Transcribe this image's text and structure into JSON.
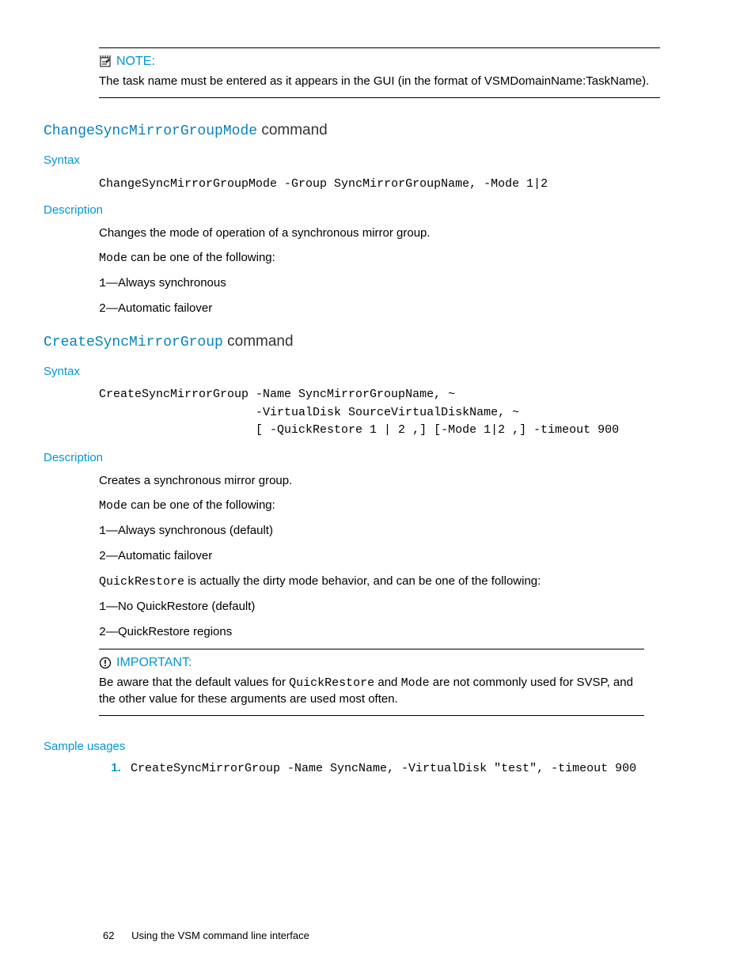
{
  "note": {
    "label": "NOTE:",
    "body": "The task name must be entered as it appears in the GUI (in the format of VSMDomainName:TaskName)."
  },
  "cmd1": {
    "heading_code": "ChangeSyncMirrorGroupMode",
    "heading_tail": " command",
    "syntax_label": "Syntax",
    "syntax_prefix": "ChangeSyncMirrorGroupMode",
    "syntax_tail": " -Group SyncMirrorGroupName, -Mode 1|2",
    "desc_label": "Description",
    "desc_line": "Changes the mode of operation of a synchronous mirror group.",
    "mode_label": "Mode",
    "mode_tail": " can be one of the following:",
    "m1_code": "1",
    "m1_tail": "—Always synchronous",
    "m2_code": "2",
    "m2_tail": "—Automatic failover"
  },
  "cmd2": {
    "heading_code": "CreateSyncMirrorGroup",
    "heading_tail": " command",
    "syntax_label": "Syntax",
    "syntax_block": "CreateSyncMirrorGroup -Name SyncMirrorGroupName, ~\n                      -VirtualDisk SourceVirtualDiskName, ~\n                      [ -QuickRestore 1 | 2 ,] [-Mode 1|2 ,] -timeout 900",
    "desc_label": "Description",
    "desc_line": "Creates a synchronous mirror group.",
    "mode_label": "Mode",
    "mode_tail": " can be one of the following:",
    "m1_code": "1",
    "m1_tail": "—Always synchronous (default)",
    "m2_code": "2",
    "m2_tail": "—Automatic failover",
    "qr_label": "QuickRestore",
    "qr_tail": " is actually the dirty mode behavior, and can be one of the following:",
    "q1_code": "1",
    "q1_tail": "—No QuickRestore (default)",
    "q2_code": "2",
    "q2_tail": "—QuickRestore regions"
  },
  "important": {
    "label": "IMPORTANT:",
    "body_pre": "Be aware that the default values for ",
    "qr": "QuickRestore",
    "body_mid": " and ",
    "mode": "Mode",
    "body_post": " are not commonly used for SVSP, and the other value for these arguments are used most often."
  },
  "sample": {
    "label": "Sample usages",
    "item1": "CreateSyncMirrorGroup -Name SyncName, -VirtualDisk \"test\", -timeout 900"
  },
  "footer": {
    "page": "62",
    "title": "Using the VSM command line interface"
  }
}
